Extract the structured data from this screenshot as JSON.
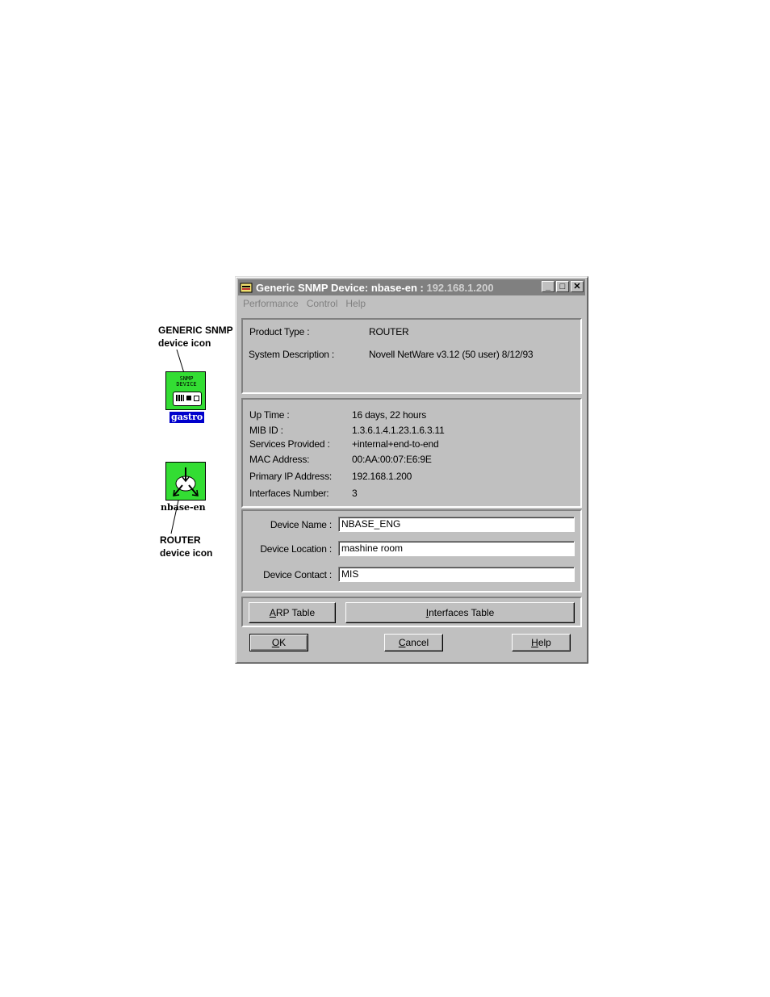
{
  "annotations": {
    "generic_callout_line1": "GENERIC SNMP",
    "generic_callout_line2": "device icon",
    "generic_icon_label": "gastro",
    "generic_icon_text1": "SNMP",
    "generic_icon_text2": "DEVICE",
    "router_icon_label": "nbase-en",
    "router_callout_line1": "ROUTER",
    "router_callout_line2": "device icon"
  },
  "window": {
    "title": "Generic SNMP Device: nbase-en :",
    "title_ip": "192.168.1.200",
    "minimize_glyph": "_",
    "maximize_glyph": "□",
    "close_glyph": "✕",
    "menu": [
      "Performance",
      "Control",
      "Help"
    ]
  },
  "info": {
    "product_type_label": "Product Type :",
    "product_type_value": "ROUTER",
    "system_desc_label": "System Description :",
    "system_desc_value": "Novell NetWare v3.12 (50 user)  8/12/93"
  },
  "stats": [
    {
      "label": "Up Time :",
      "value": "16 days, 22 hours"
    },
    {
      "label": "MIB ID :",
      "value": "1.3.6.1.4.1.23.1.6.3.11"
    },
    {
      "label": "Services Provided :",
      "value": "+internal+end-to-end"
    },
    {
      "label": "MAC Address:",
      "value": "00:AA:00:07:E6:9E"
    },
    {
      "label": "Primary IP Address:",
      "value": "192.168.1.200"
    },
    {
      "label": "Interfaces Number:",
      "value": "3"
    }
  ],
  "form": {
    "device_name_label": "Device Name :",
    "device_name_value": "NBASE_ENG",
    "device_location_label": "Device Location :",
    "device_location_value": "mashine room",
    "device_contact_label": "Device Contact :",
    "device_contact_value": "MIS"
  },
  "buttons": {
    "arp_table_first": "A",
    "arp_table_rest": "RP Table",
    "interfaces_table_first": "I",
    "interfaces_table_rest": "nterfaces Table",
    "ok_first": "O",
    "ok_rest": "K",
    "cancel_first": "C",
    "cancel_rest": "ancel",
    "help_first": "H",
    "help_rest": "elp"
  },
  "colors": {
    "icon_green": "#33dd33",
    "label_highlight": "#0000cc",
    "titlebar": "#808080",
    "window_face": "#c0c0c0"
  }
}
